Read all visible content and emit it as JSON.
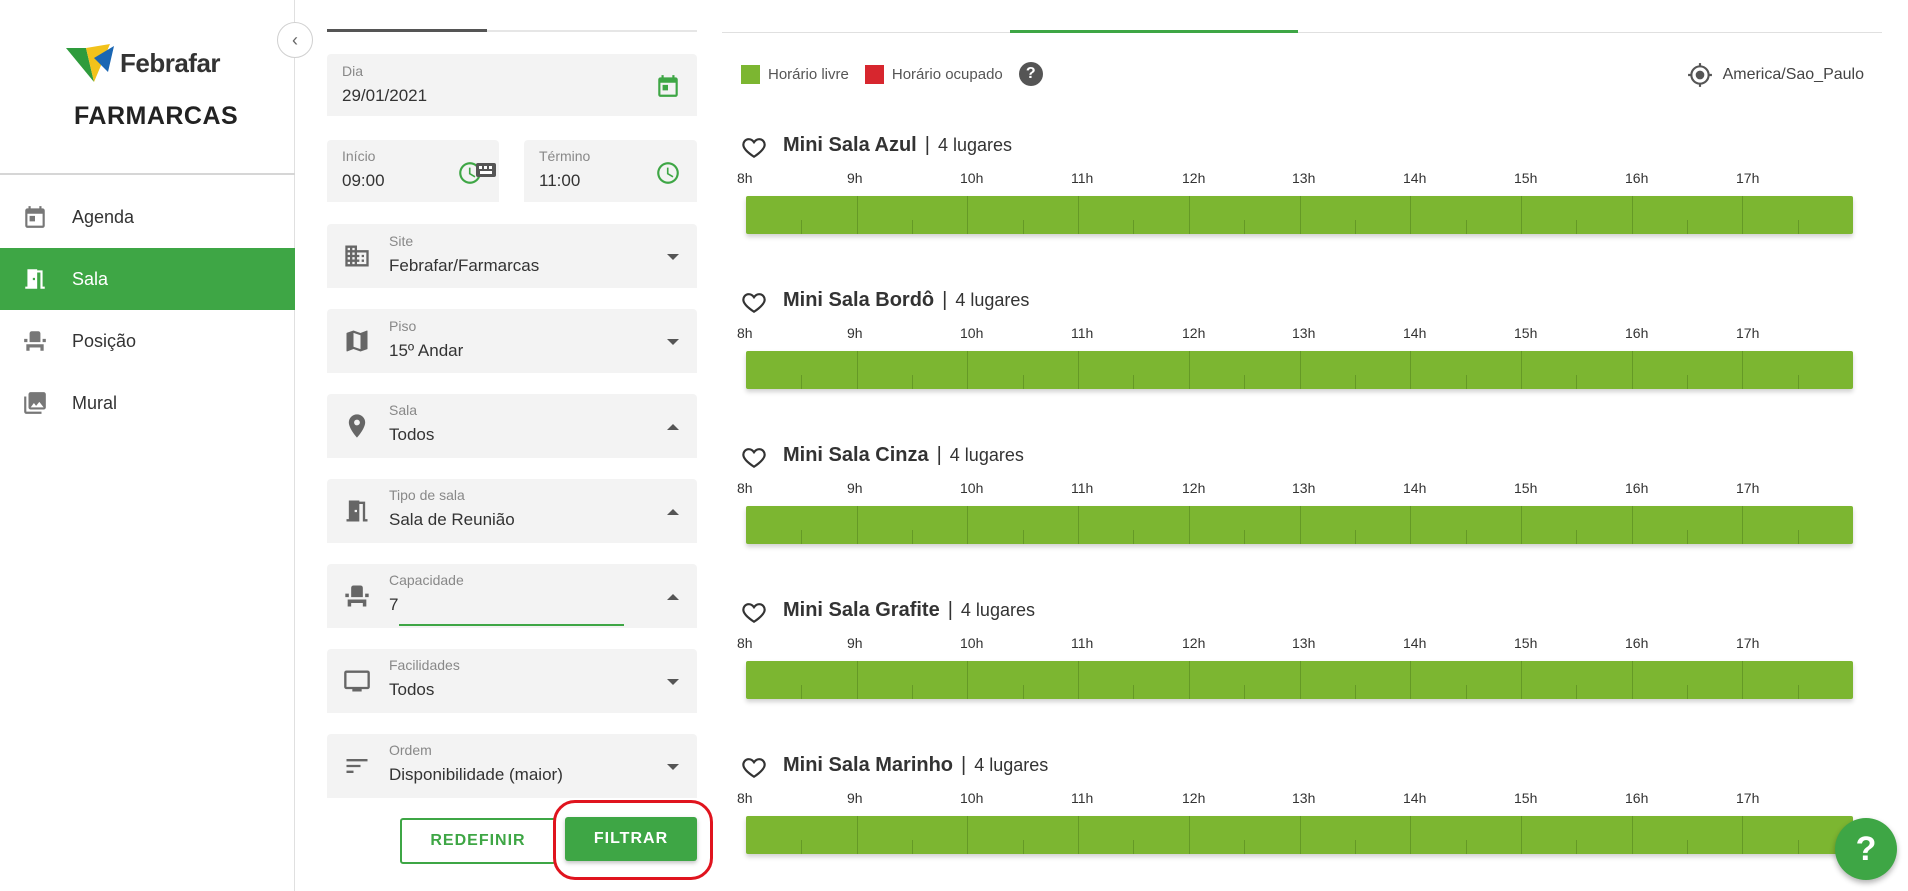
{
  "brand": {
    "line1": "Febrafar",
    "line2": "FARMARCAS"
  },
  "colors": {
    "accent": "#3ea645",
    "free": "#7cb631",
    "busy": "#d7262e",
    "highlight": "#e0141e"
  },
  "sidebar": {
    "items": [
      {
        "label": "Agenda",
        "icon": "calendar-icon",
        "active": false
      },
      {
        "label": "Sala",
        "icon": "door-icon",
        "active": true
      },
      {
        "label": "Posição",
        "icon": "seat-icon",
        "active": false
      },
      {
        "label": "Mural",
        "icon": "image-icon",
        "active": false
      }
    ]
  },
  "filters": {
    "dia": {
      "label": "Dia",
      "value": "29/01/2021"
    },
    "inicio": {
      "label": "Início",
      "value": "09:00"
    },
    "termino": {
      "label": "Término",
      "value": "11:00"
    },
    "site": {
      "label": "Site",
      "value": "Febrafar/Farmarcas"
    },
    "piso": {
      "label": "Piso",
      "value": "15º Andar"
    },
    "sala": {
      "label": "Sala",
      "value": "Todos"
    },
    "tipo": {
      "label": "Tipo de sala",
      "value": "Sala de Reunião"
    },
    "capacidade": {
      "label": "Capacidade",
      "value": "7"
    },
    "facilidades": {
      "label": "Facilidades",
      "value": "Todos"
    },
    "ordem": {
      "label": "Ordem",
      "value": "Disponibilidade (maior)"
    },
    "redefinir": "REDEFINIR",
    "filtrar": "FILTRAR"
  },
  "legend": {
    "free": "Horário livre",
    "busy": "Horário ocupado",
    "help": "?"
  },
  "timezone": "America/Sao_Paulo",
  "hours": [
    "8h",
    "9h",
    "10h",
    "11h",
    "12h",
    "13h",
    "14h",
    "15h",
    "16h",
    "17h"
  ],
  "rooms": [
    {
      "name": "Mini Sala Azul",
      "separator": "|",
      "capacity": "4 lugares",
      "availability": "free"
    },
    {
      "name": "Mini Sala Bordô",
      "separator": "|",
      "capacity": "4 lugares",
      "availability": "free"
    },
    {
      "name": "Mini Sala Cinza",
      "separator": "|",
      "capacity": "4 lugares",
      "availability": "free"
    },
    {
      "name": "Mini Sala Grafite",
      "separator": "|",
      "capacity": "4 lugares",
      "availability": "free"
    },
    {
      "name": "Mini Sala Marinho",
      "separator": "|",
      "capacity": "4 lugares",
      "availability": "free"
    }
  ],
  "fab": "?"
}
